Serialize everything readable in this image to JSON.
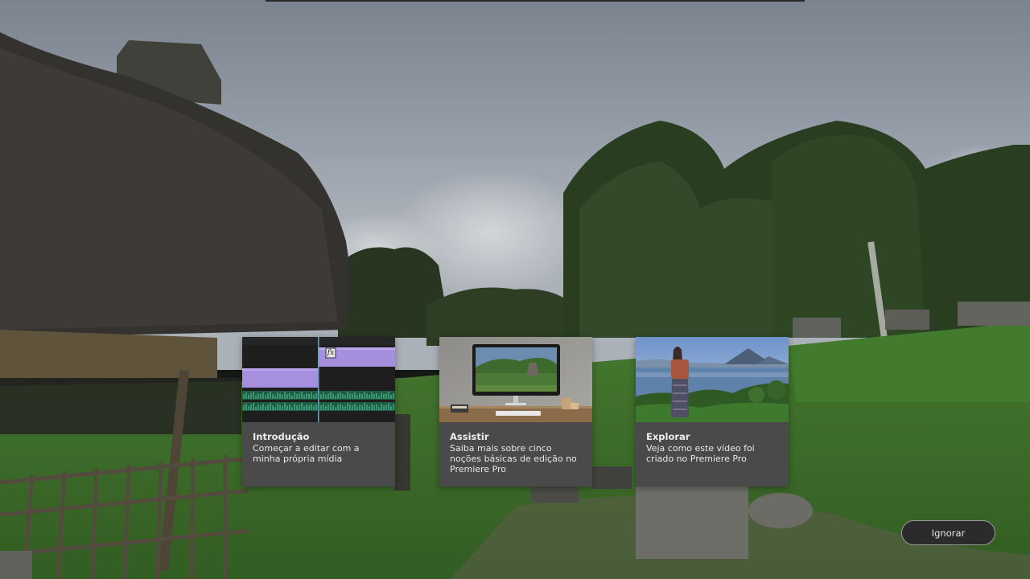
{
  "cards": [
    {
      "id": "intro",
      "title": "Introdução",
      "description": "Começar a editar com a minha própria mídia",
      "thumbnail": "timeline-editing-thumbnail"
    },
    {
      "id": "watch",
      "title": "Assistir",
      "description": "Saiba mais sobre cinco noções básicas de edição no Premiere Pro",
      "thumbnail": "desktop-monitor-thumbnail"
    },
    {
      "id": "explore",
      "title": "Explorar",
      "description": "Veja como este vídeo foi criado no Premiere Pro",
      "thumbnail": "lake-volcano-thumbnail"
    }
  ],
  "skip_button": {
    "label": "Ignorar"
  },
  "timeline_fx_badge": "fx",
  "colors": {
    "card_bg": "#4a4a4a",
    "clip_purple": "#a58fde",
    "audio_green": "#3fbf8a",
    "playhead": "#4fa9d6"
  }
}
